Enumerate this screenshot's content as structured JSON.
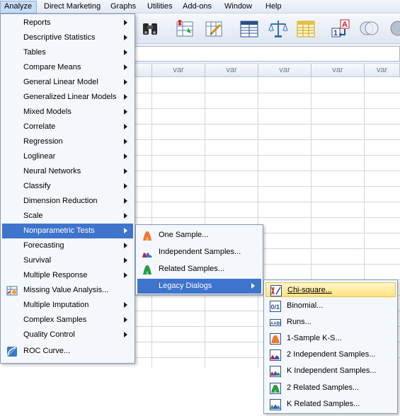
{
  "menubar": {
    "items": [
      "Analyze",
      "Direct Marketing",
      "Graphs",
      "Utilities",
      "Add-ons",
      "Window",
      "Help"
    ]
  },
  "grid": {
    "columns": [
      "var",
      "var",
      "var",
      "var",
      "var"
    ]
  },
  "analyze_menu": {
    "items": [
      {
        "label": "Reports",
        "submenu": true
      },
      {
        "label": "Descriptive Statistics",
        "submenu": true
      },
      {
        "label": "Tables",
        "submenu": true
      },
      {
        "label": "Compare Means",
        "submenu": true
      },
      {
        "label": "General Linear Model",
        "submenu": true
      },
      {
        "label": "Generalized Linear Models",
        "submenu": true
      },
      {
        "label": "Mixed Models",
        "submenu": true
      },
      {
        "label": "Correlate",
        "submenu": true
      },
      {
        "label": "Regression",
        "submenu": true
      },
      {
        "label": "Loglinear",
        "submenu": true
      },
      {
        "label": "Neural Networks",
        "submenu": true
      },
      {
        "label": "Classify",
        "submenu": true
      },
      {
        "label": "Dimension Reduction",
        "submenu": true
      },
      {
        "label": "Scale",
        "submenu": true
      },
      {
        "label": "Nonparametric Tests",
        "submenu": true,
        "highlighted": true
      },
      {
        "label": "Forecasting",
        "submenu": true
      },
      {
        "label": "Survival",
        "submenu": true
      },
      {
        "label": "Multiple Response",
        "submenu": true
      },
      {
        "label": "Missing Value Analysis...",
        "icon": "missing-value-icon"
      },
      {
        "label": "Multiple Imputation",
        "submenu": true
      },
      {
        "label": "Complex Samples",
        "submenu": true
      },
      {
        "label": "Quality Control",
        "submenu": true
      },
      {
        "label": "ROC Curve...",
        "icon": "roc-curve-icon"
      }
    ]
  },
  "nonparametric_menu": {
    "items": [
      {
        "label": "One Sample...",
        "icon": "one-sample-icon"
      },
      {
        "label": "Independent Samples...",
        "icon": "independent-samples-icon"
      },
      {
        "label": "Related Samples...",
        "icon": "related-samples-icon"
      },
      {
        "label": "Legacy Dialogs",
        "submenu": true,
        "highlighted": true
      }
    ]
  },
  "legacy_menu": {
    "items": [
      {
        "label": "Chi-square...",
        "icon": "chi-square-icon",
        "highlighted": true
      },
      {
        "label": "Binomial...",
        "icon": "binomial-icon"
      },
      {
        "label": "Runs...",
        "icon": "runs-icon"
      },
      {
        "label": "1-Sample K-S...",
        "icon": "one-sample-ks-icon"
      },
      {
        "label": "2 Independent Samples...",
        "icon": "two-independent-samples-icon"
      },
      {
        "label": "K Independent Samples...",
        "icon": "k-independent-samples-icon"
      },
      {
        "label": "2 Related Samples...",
        "icon": "two-related-samples-icon"
      },
      {
        "label": "K Related Samples...",
        "icon": "k-related-samples-icon"
      }
    ]
  },
  "toolbar": {
    "icons": [
      "find-icon",
      "insert-cases-icon",
      "insert-variable-icon",
      "split-file-icon",
      "weight-cases-icon",
      "select-cases-icon",
      "value-labels-icon",
      "use-sets-icon",
      "show-all-icon"
    ]
  }
}
